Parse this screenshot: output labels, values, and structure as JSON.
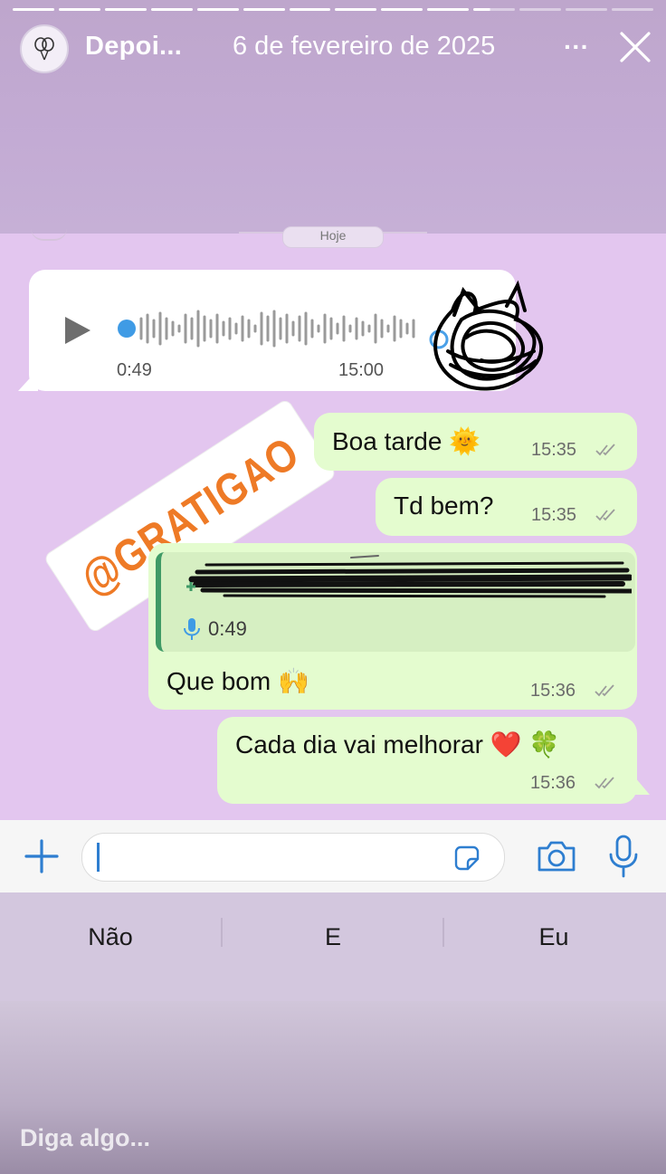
{
  "story": {
    "account_name": "Depoi...",
    "date": "6 de fevereiro de 2025",
    "more_label": "···",
    "reply_placeholder": "Diga algo..."
  },
  "chat": {
    "day_pill": "Hoje",
    "incoming_voice": {
      "duration": "0:49",
      "time": "15:00"
    },
    "sticker_text": "@GRATIGAO",
    "messages": [
      {
        "text": "Boa tarde 🌞",
        "time": "15:35"
      },
      {
        "text": "Td bem?",
        "time": "15:35"
      },
      {
        "text": "Que bom 🙌",
        "time": "15:36",
        "quote_duration": "0:49"
      },
      {
        "text": "Cada dia vai melhorar ❤️ 🍀",
        "time": "15:36"
      }
    ]
  },
  "keyboard": {
    "suggestions": [
      "Não",
      "E",
      "Eu"
    ]
  },
  "colors": {
    "outgoing_bubble": "#e4fccf",
    "chat_wallpaper": "#e3c6ef",
    "accent_blue": "#2e7ed0",
    "sticker_orange": "#ee7a26"
  }
}
